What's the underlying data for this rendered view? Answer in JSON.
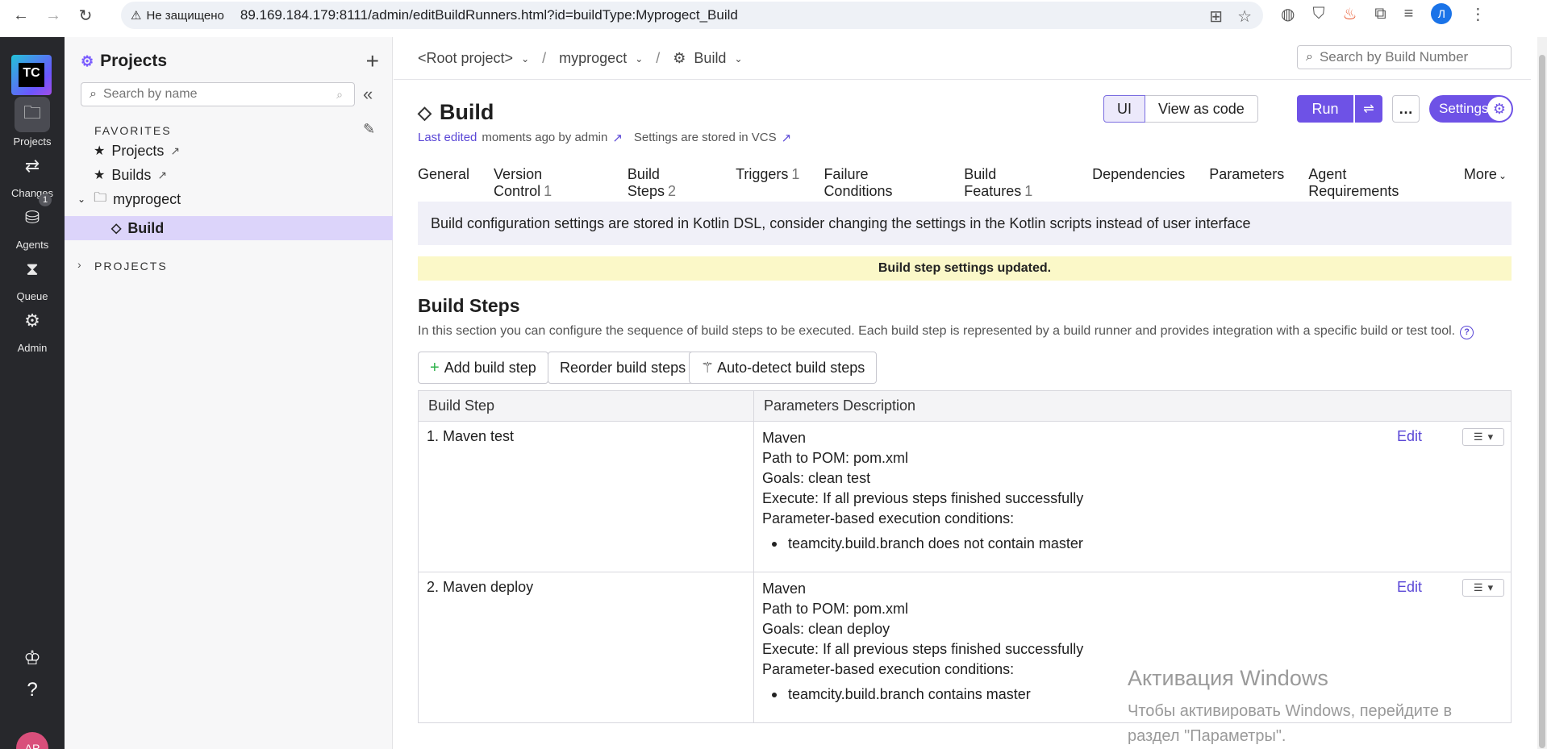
{
  "browser": {
    "security_label": "Не защищено",
    "url": "89.169.184.179:8111/admin/editBuildRunners.html?id=buildType:Myprogect_Build",
    "profile_initial": "Л"
  },
  "leftnav": {
    "logo": "TC",
    "items": [
      {
        "label": "Projects"
      },
      {
        "label": "Changes"
      },
      {
        "label": "Agents",
        "badge": "1"
      },
      {
        "label": "Queue"
      },
      {
        "label": "Admin"
      }
    ],
    "user_initials": "AP"
  },
  "sidebar": {
    "title": "Projects",
    "search_placeholder": "Search by name",
    "favorites_label": "FAVORITES",
    "items": [
      {
        "label": "Projects"
      },
      {
        "label": "Builds"
      },
      {
        "label": "myprogect"
      },
      {
        "label": "Build"
      }
    ],
    "projects_label": "PROJECTS"
  },
  "breadcrumb": {
    "root": "<Root project>",
    "project": "myprogect",
    "build": "Build"
  },
  "build_search_placeholder": "Search by Build Number",
  "header": {
    "title": "Build",
    "last_edited_label": "Last edited",
    "last_edited_rest": "moments ago by admin",
    "settings_vcs": "Settings are stored in VCS",
    "ui_label": "UI",
    "view_as_code_label": "View as code",
    "run_label": "Run",
    "settings_label": "Settings"
  },
  "tabs": [
    {
      "label": "General",
      "count": ""
    },
    {
      "label": "Version Control",
      "count": "1"
    },
    {
      "label": "Build Steps",
      "count": "2"
    },
    {
      "label": "Triggers",
      "count": "1"
    },
    {
      "label": "Failure Conditions",
      "count": ""
    },
    {
      "label": "Build Features",
      "count": "1"
    },
    {
      "label": "Dependencies",
      "count": ""
    },
    {
      "label": "Parameters",
      "count": ""
    },
    {
      "label": "Agent Requirements",
      "count": ""
    },
    {
      "label": "More",
      "count": ""
    }
  ],
  "info_message": "Build configuration settings are stored in Kotlin DSL, consider changing the settings in the Kotlin scripts instead of user interface",
  "notice_message": "Build step settings updated.",
  "section": {
    "title": "Build Steps",
    "description": "In this section you can configure the sequence of build steps to be executed. Each build step is represented by a build runner and provides integration with a specific build or test tool."
  },
  "buttons": {
    "add": "Add build step",
    "reorder": "Reorder build steps",
    "autodetect": "Auto-detect build steps"
  },
  "table": {
    "headers": [
      "Build Step",
      "Parameters Description"
    ],
    "edit_label": "Edit",
    "rows": [
      {
        "name": "1. Maven test",
        "runner": "Maven",
        "pom": "Path to POM: pom.xml",
        "goals": "Goals: clean test",
        "execute": "Execute: If all previous steps finished successfully",
        "conditions_label": "Parameter-based execution conditions:",
        "condition": "teamcity.build.branch does not contain master"
      },
      {
        "name": "2. Maven deploy",
        "runner": "Maven",
        "pom": "Path to POM: pom.xml",
        "goals": "Goals: clean deploy",
        "execute": "Execute: If all previous steps finished successfully",
        "conditions_label": "Parameter-based execution conditions:",
        "condition": "teamcity.build.branch contains master"
      }
    ]
  },
  "watermark": {
    "line1": "Активация Windows",
    "line2": "Чтобы активировать Windows, перейдите в",
    "line3": "раздел \"Параметры\"."
  }
}
